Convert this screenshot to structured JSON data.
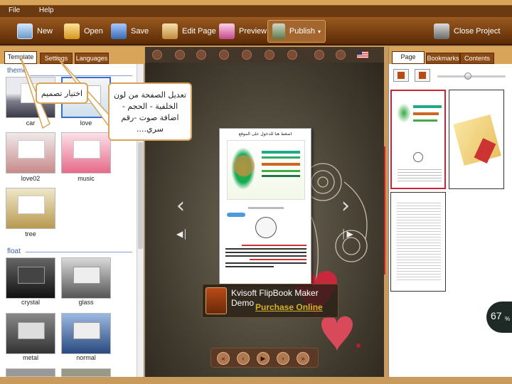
{
  "menu": {
    "file": "File",
    "help": "Help"
  },
  "toolbar": {
    "new": "New",
    "open": "Open",
    "save": "Save",
    "edit_page": "Edit Page",
    "preview": "Preview",
    "publish": "Publish",
    "close_project": "Close Project"
  },
  "left_tabs": {
    "template": "Template",
    "settings": "Settings",
    "languages": "Languages"
  },
  "sections": {
    "theme": "theme",
    "float": "float"
  },
  "theme_items": [
    "car",
    "love",
    "love02",
    "music",
    "tree"
  ],
  "float_items": [
    "crystal",
    "glass",
    "metal",
    "normal"
  ],
  "annotations": {
    "choose_design": "اختيار تصميم",
    "edit_page": "تعديل الصفحة من لون الخلفية - الحجم - اضافة صوت -رقم سري...."
  },
  "book": {
    "page_title": "اضغط هنا للدخول على الموقع",
    "demo_title": "Kvisoft FlipBook Maker Demo",
    "purchase": "Purchase Online"
  },
  "right_tabs": {
    "page": "Page",
    "bookmarks": "Bookmarks",
    "contents": "Contents"
  },
  "zoom": {
    "percent": "67",
    "unit": "%",
    "slider_level": 0.5
  },
  "colors": {
    "accent": "#d8a45a",
    "toolbar": "#6b3a10",
    "selection": "#3a6fd0",
    "link": "#c8a020"
  }
}
